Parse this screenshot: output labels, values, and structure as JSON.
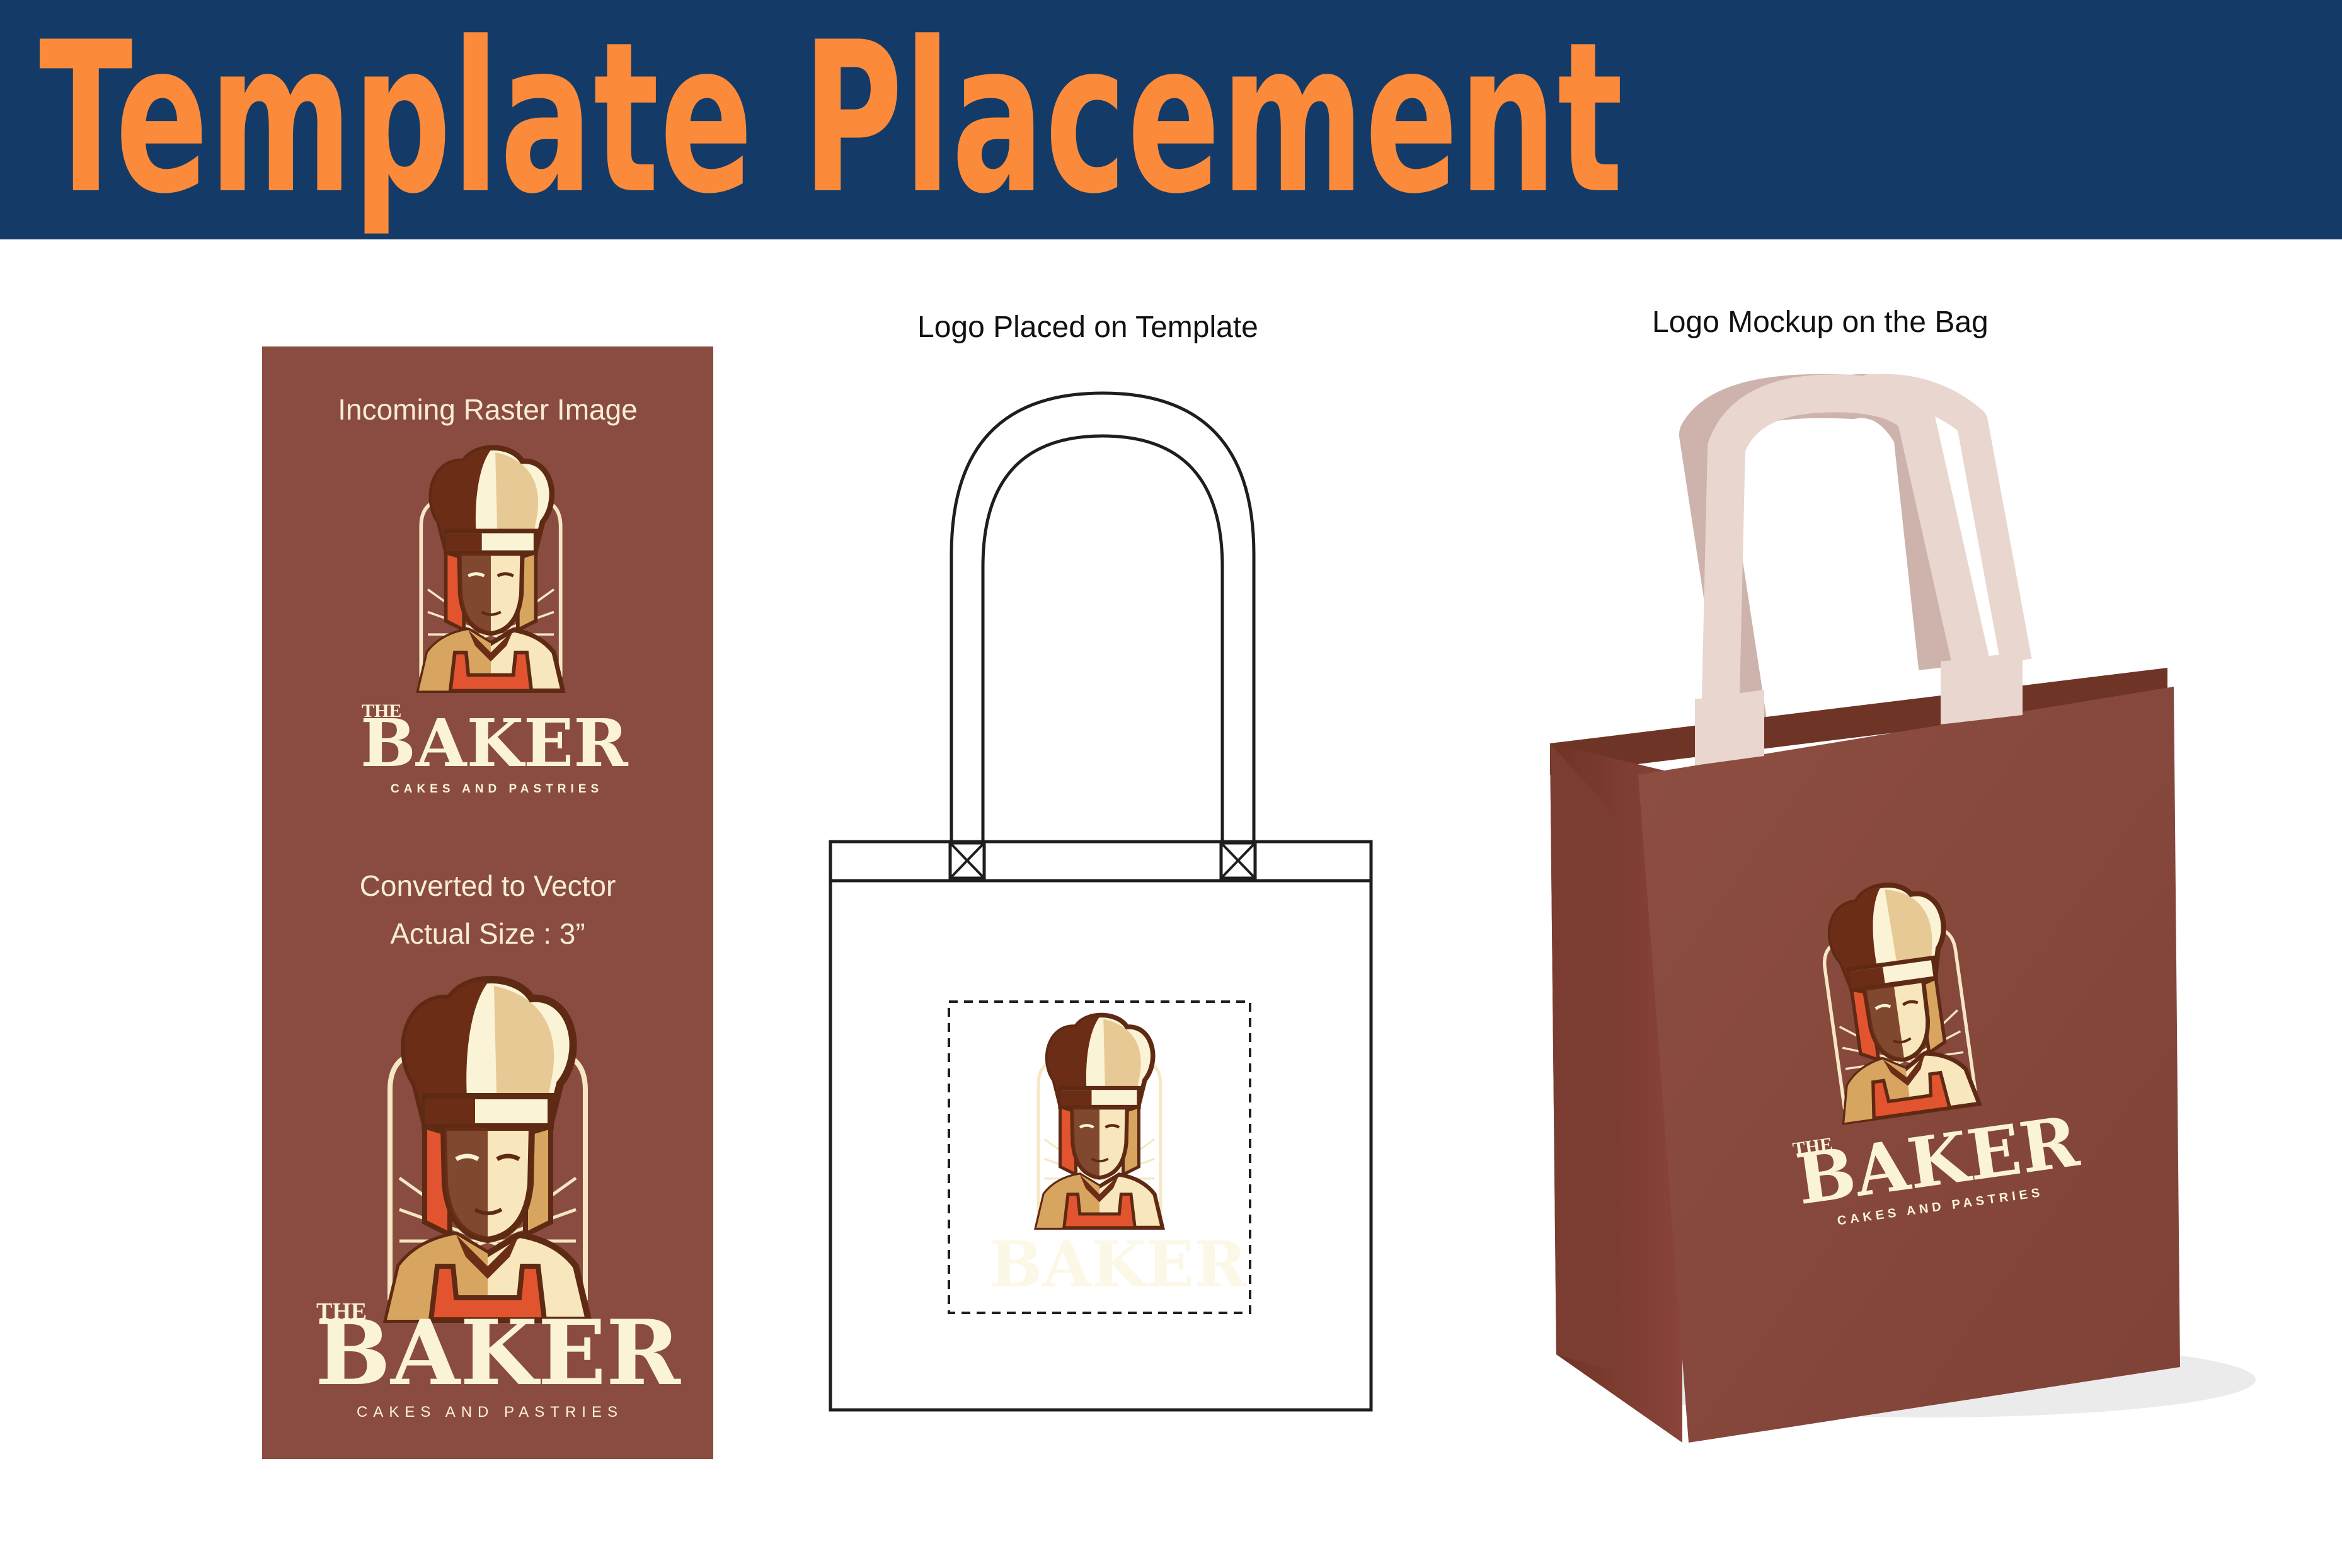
{
  "header": {
    "title": "Template Placement",
    "background_color": "#143b67",
    "title_color": "#fb8a3a"
  },
  "raster_panel": {
    "background_color": "#8a4c40",
    "incoming_label": "Incoming Raster Image",
    "converted_label": "Converted to Vector",
    "size_label": "Actual Size : 3”"
  },
  "template_section": {
    "caption": "Logo Placed on Template"
  },
  "mockup_section": {
    "caption": "Logo Mockup on the Bag",
    "bag_color": "#8a4c40",
    "handle_color": "#e8d6cf"
  },
  "logo": {
    "the": "THE",
    "name": "BAKER",
    "tagline": "CAKES AND PASTRIES",
    "cream_color": "#fbf3d6",
    "brown_color": "#5e2a14",
    "red_color": "#e2542f",
    "tan_color": "#d7a560"
  }
}
